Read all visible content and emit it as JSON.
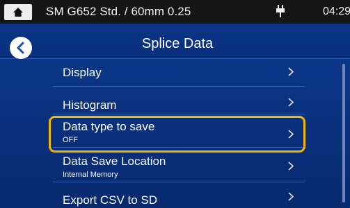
{
  "status_bar": {
    "title": "SM G652 Std. / 60mm 0.25",
    "time": "04:29",
    "icons": [
      "home-icon",
      "plug-icon"
    ]
  },
  "header": {
    "title": "Splice Data",
    "back_icon": "chevron-left-icon"
  },
  "menu": {
    "items": [
      {
        "label": "Display",
        "value": ""
      },
      {
        "label": "Histogram",
        "value": ""
      },
      {
        "label": "Data type to save",
        "value": "OFF",
        "highlighted": true
      },
      {
        "label": "Data Save Location",
        "value": "Internal Memory"
      },
      {
        "label": "Export CSV to SD",
        "value": ""
      }
    ]
  },
  "colors": {
    "background": "#0b3484",
    "status_bar": "#151515",
    "highlight": "#f5b800",
    "text": "#ffffff"
  }
}
